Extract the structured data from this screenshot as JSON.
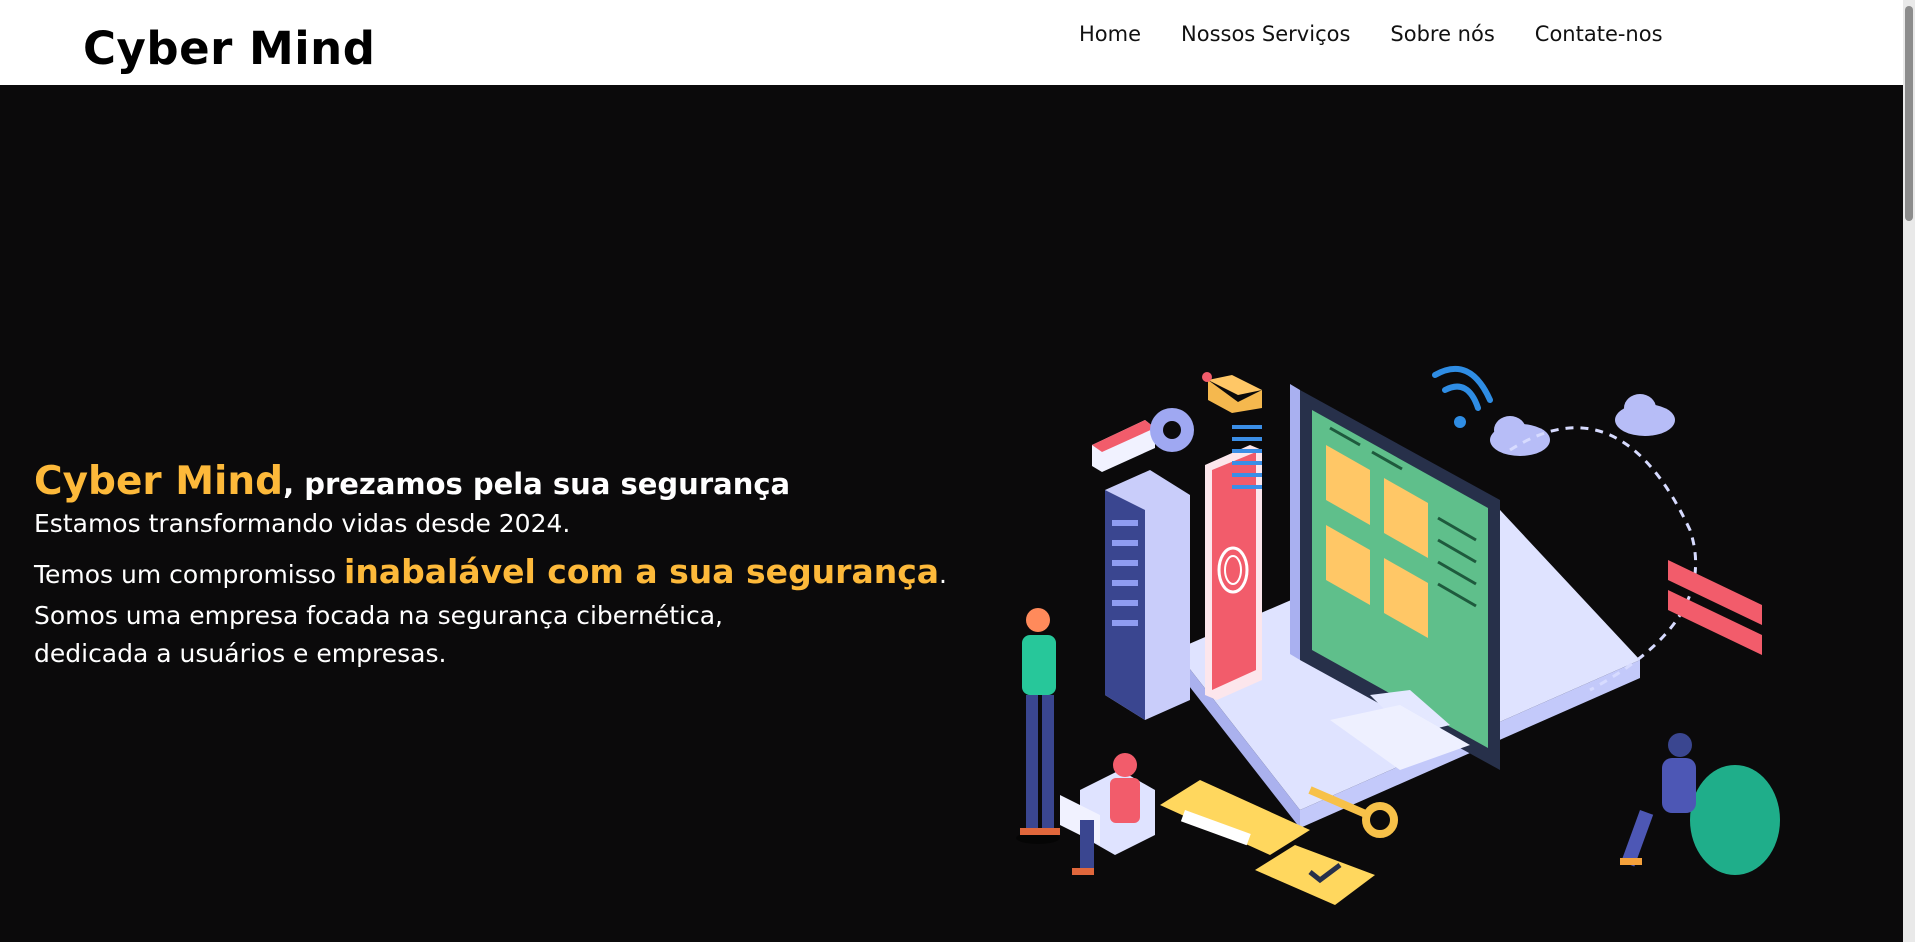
{
  "navbar": {
    "brand": "Cyber Mind",
    "links": [
      "Home",
      "Nossos Serviços",
      "Sobre nós",
      "Contate-nos"
    ]
  },
  "hero": {
    "headline_brand": "Cyber Mind",
    "headline_rest": ", prezamos pela sua segurança",
    "line1": "Estamos transformando vidas desde 2024.",
    "line2_prefix": "Temos um compromisso ",
    "line2_accent": "inabalável com a sua segurança",
    "line2_suffix": ".",
    "line3": "Somos uma empresa focada na segurança cibernética,",
    "line4": "dedicada a usuários e empresas."
  },
  "colors": {
    "accent": "#fdb93a",
    "background": "#0b0a0b",
    "navbar": "#ffffff"
  },
  "illustration": {
    "icon": "cyber-security-illustration"
  }
}
